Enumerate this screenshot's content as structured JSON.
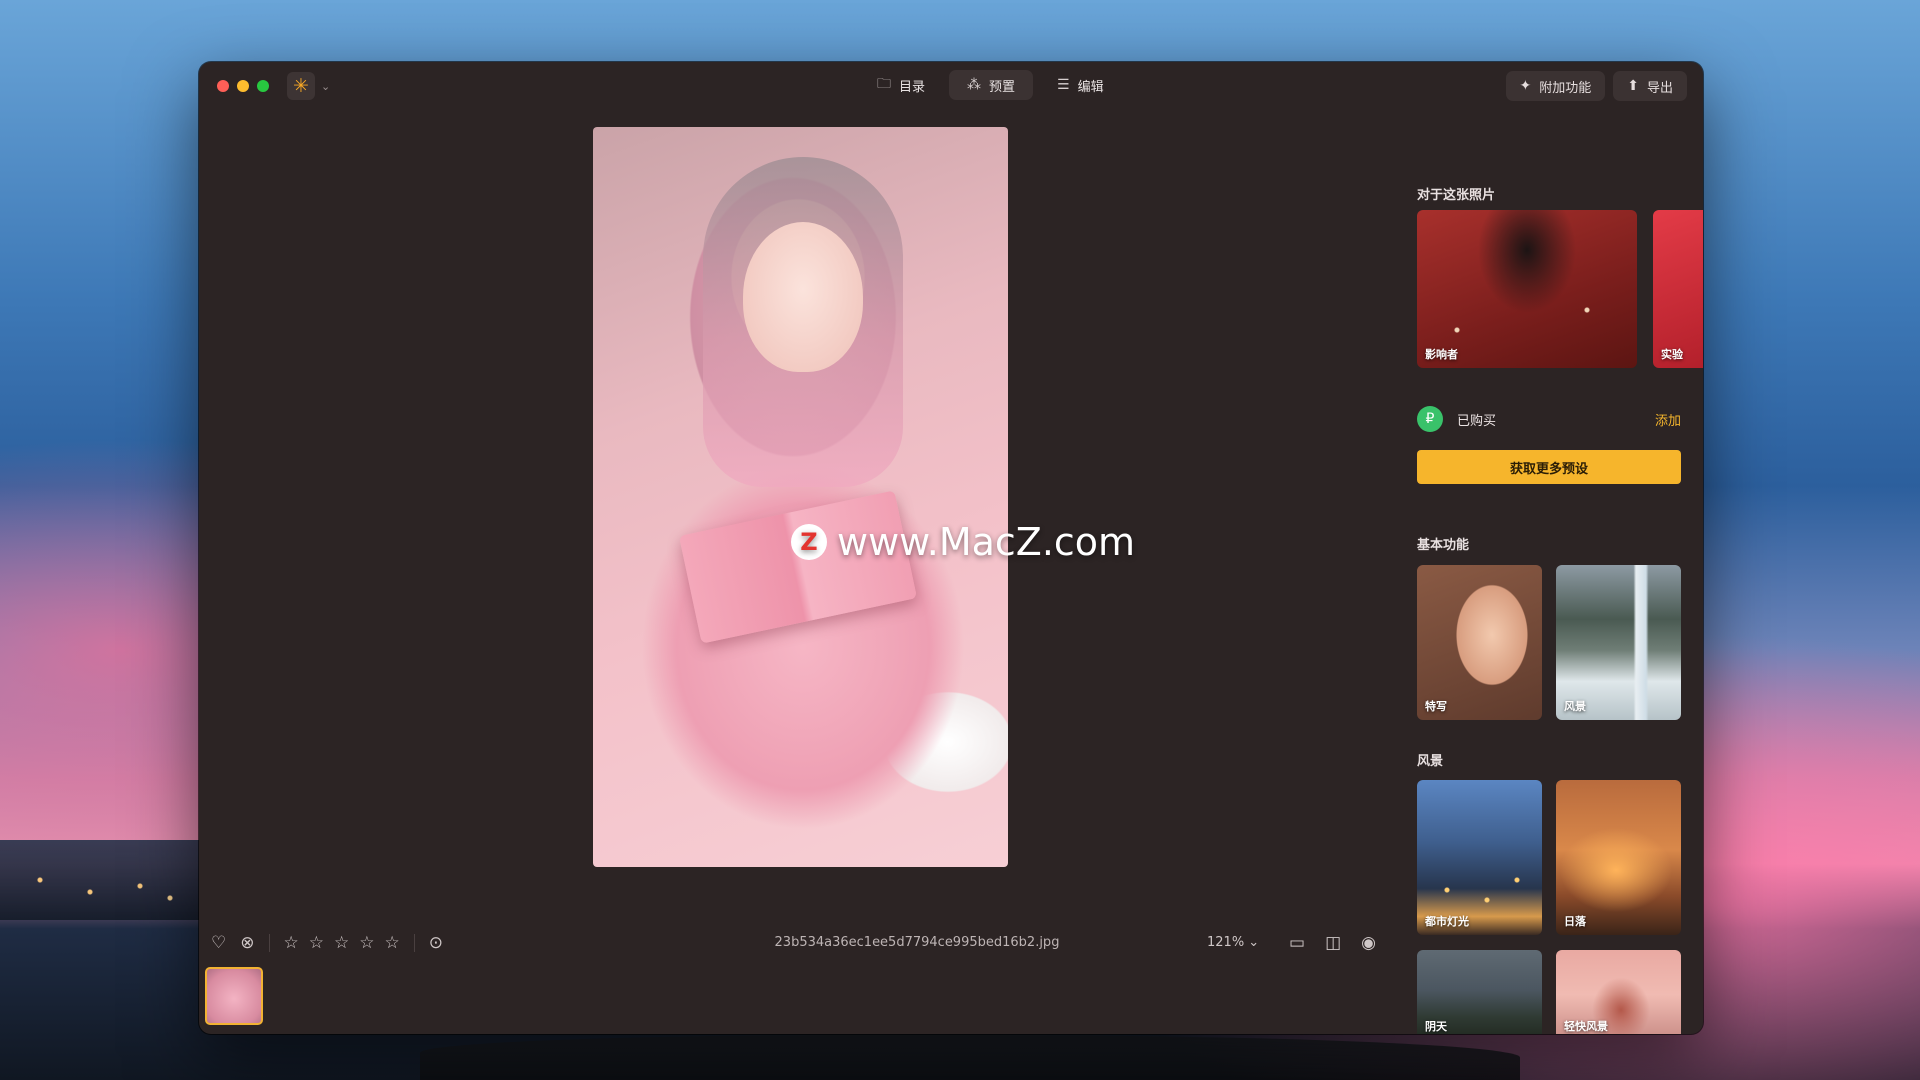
{
  "window": {
    "tabs": [
      {
        "label": "目录",
        "icon": "folder-icon"
      },
      {
        "label": "预置",
        "icon": "sparkle-wand-icon"
      },
      {
        "label": "编辑",
        "icon": "sliders-icon"
      }
    ],
    "actions": {
      "addons_label": "附加功能",
      "export_label": "导出"
    }
  },
  "viewer": {
    "watermark": "www.MacZ.com",
    "watermark_logo": "Z",
    "filename": "23b534a36ec1ee5d7794ce995bed16b2.jpg",
    "zoom": "121%"
  },
  "sidebar": {
    "about_title": "对于这张照片",
    "about_cards": [
      {
        "label": "影响者"
      },
      {
        "label": "实验"
      }
    ],
    "purchased_label": "已购买",
    "add_label": "添加",
    "get_more_label": "获取更多预设",
    "basic_title": "基本功能",
    "basic_cards": [
      {
        "label": "特写"
      },
      {
        "label": "风景"
      }
    ],
    "landscape_title": "风景",
    "landscape_cards": [
      {
        "label": "都市灯光"
      },
      {
        "label": "日落"
      },
      {
        "label": "阴天"
      },
      {
        "label": "轻快风景"
      }
    ]
  },
  "colors": {
    "accent": "#f6b52c",
    "window_bg": "#2c2424",
    "purchased_green": "#39c26a"
  }
}
